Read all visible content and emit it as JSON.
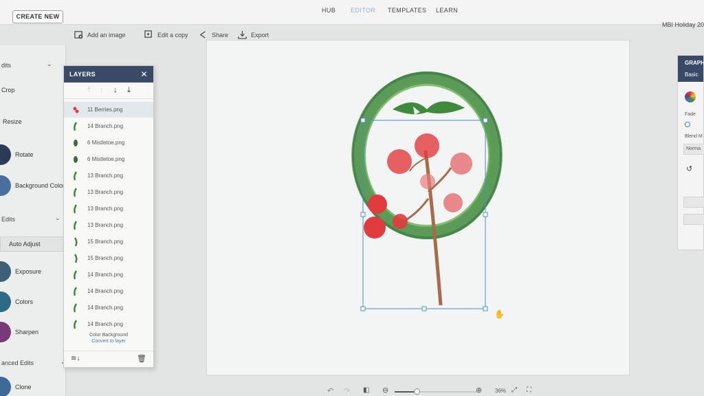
{
  "topbar": {
    "create_label": "CREATE NEW",
    "nav": [
      "HUB",
      "EDITOR",
      "TEMPLATES",
      "LEARN"
    ],
    "active_nav": "EDITOR",
    "doc_title": "MBI Holiday 20"
  },
  "toolbar": {
    "add_image": "Add an image",
    "edit_copy": "Edit a copy",
    "share": "Share",
    "export": "Export"
  },
  "left_panel": {
    "edits_section": "dits",
    "crop": "Crop",
    "resize": "Resize",
    "rotate": "Rotate",
    "background_color": "Background Color",
    "edits2_section": "Edits",
    "auto_adjust": "Auto Adjust",
    "exposure": "Exposure",
    "colors": "Colors",
    "sharpen": "Sharpen",
    "advanced_section": "anced Edits",
    "clone": "Clone"
  },
  "layers": {
    "title": "LAYERS",
    "close": "✕",
    "items": [
      "11 Berries.png",
      "14 Branch.png",
      "6 Mistletoe.png",
      "6 Mistletoe.png",
      "13 Branch.png",
      "13 Branch.png",
      "13 Branch.png",
      "13 Branch.png",
      "15 Branch.png",
      "15 Branch.png",
      "14 Branch.png",
      "14 Branch.png",
      "14 Branch.png",
      "14 Branch.png"
    ],
    "color_background": "Color Background",
    "convert_to_layer": "Convert to layer"
  },
  "right_panel": {
    "title": "GRAPH",
    "tab": "Basic",
    "fade_label": "Fade",
    "blend_label": "Blend M",
    "blend_value": "Norma"
  },
  "bottombar": {
    "zoom": "36%"
  },
  "colors": {
    "accent": "#3a4a66",
    "active_nav": "#8fb3d6",
    "link": "#3d7ab8",
    "berry_red": "#e23b3e",
    "leaf_green": "#3f8a3c",
    "selection": "#4a90c8"
  }
}
